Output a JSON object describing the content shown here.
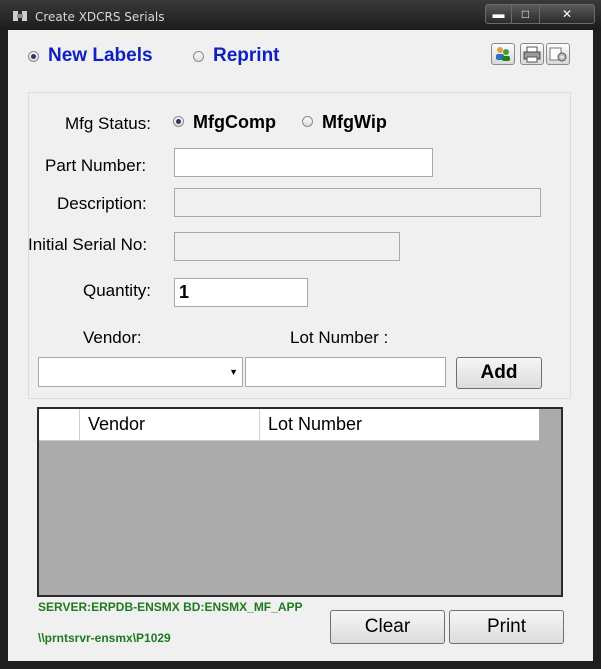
{
  "window": {
    "title": "Create XDCRS Serials",
    "minimize": "▬",
    "maximize": "□",
    "close": "✕"
  },
  "mode": {
    "new_labels": "New Labels",
    "reprint": "Reprint",
    "selected": "new_labels"
  },
  "toolbar": {
    "icons": [
      "users-icon",
      "printer-icon",
      "settings-icon"
    ]
  },
  "form": {
    "mfg_status_label": "Mfg Status:",
    "mfgcomp": "MfgComp",
    "mfgwip": "MfgWip",
    "mfg_selected": "mfgcomp",
    "part_number_label": "Part Number:",
    "part_number_value": "",
    "description_label": "Description:",
    "description_value": "",
    "initial_serial_label": "Initial Serial No:",
    "initial_serial_value": "",
    "quantity_label": "Quantity:",
    "quantity_value": "1",
    "vendor_label": "Vendor:",
    "vendor_value": "",
    "lot_number_label": "Lot Number :",
    "lot_number_value": "",
    "add_button": "Add"
  },
  "grid": {
    "columns": [
      "Vendor",
      "Lot Number"
    ],
    "rows": []
  },
  "status": {
    "server": "SERVER:ERPDB-ENSMX BD:ENSMX_MF_APP",
    "printer": "\\\\prntsrvr-ensmx\\P1029"
  },
  "buttons": {
    "clear": "Clear",
    "print": "Print"
  }
}
